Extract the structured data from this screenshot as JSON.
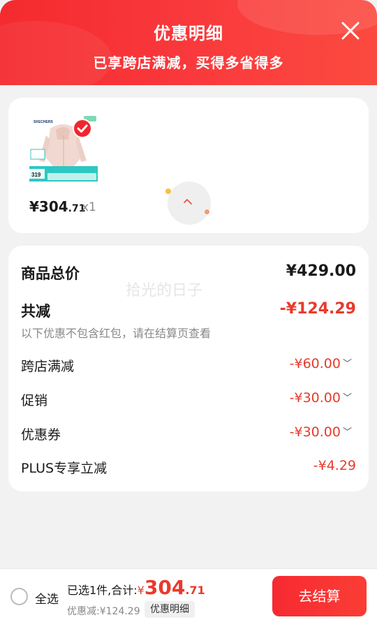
{
  "header": {
    "title": "优惠明细",
    "subtitle": "已享跨店满减，买得多省得多"
  },
  "product": {
    "brand": "SKECHERS",
    "badge_price": "319",
    "price_main": "¥304",
    "price_dec": ".71",
    "qty": "x1"
  },
  "summary_card": {
    "watermark": "拾光的日子",
    "total_label": "商品总价",
    "total_value": "¥429.00",
    "discount_label": "共减",
    "discount_value": "-¥124.29",
    "note": "以下优惠不包含红包，请在结算页查看",
    "items": [
      {
        "label": "跨店满减",
        "value": "-¥60.00",
        "chevron": true
      },
      {
        "label": "促销",
        "value": "-¥30.00",
        "chevron": true
      },
      {
        "label": "优惠券",
        "value": "-¥30.00",
        "chevron": true
      },
      {
        "label": "PLUS专享立减",
        "value": "-¥4.29",
        "chevron": false
      }
    ]
  },
  "footer": {
    "select_all": "全选",
    "selected_text": "已选1件,合计:",
    "yen": "¥",
    "amount_int": "304",
    "amount_dec": ".71",
    "discount_text": "优惠减:¥124.29",
    "detail_button": "优惠明细",
    "checkout_button": "去结算"
  },
  "colors": {
    "accent_red": "#e83a2c",
    "header_red": "#f42a2e"
  }
}
